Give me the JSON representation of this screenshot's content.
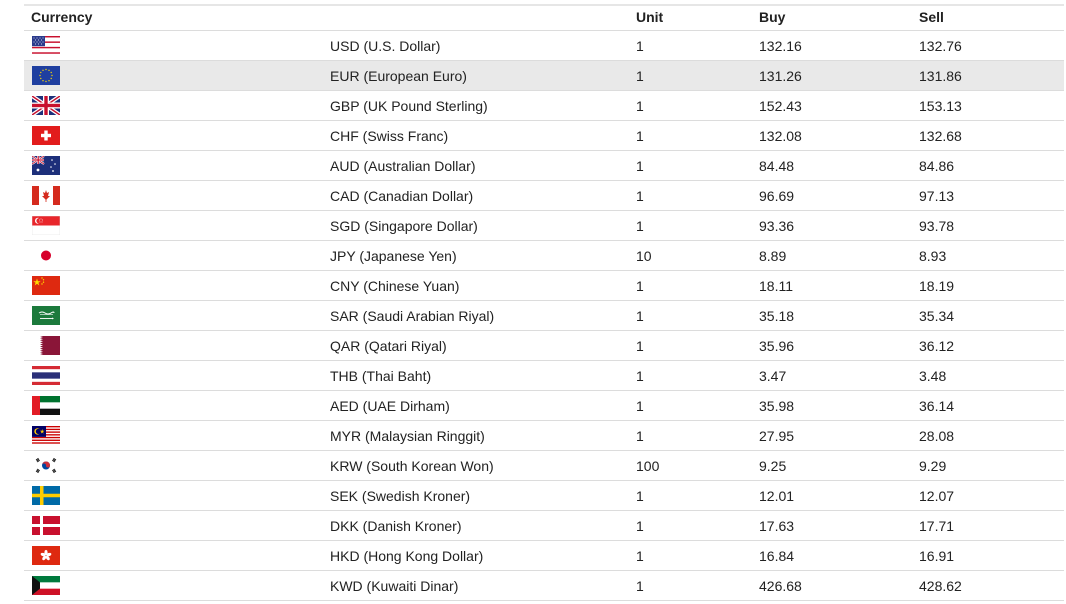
{
  "table": {
    "headers": {
      "currency": "Currency",
      "unit": "Unit",
      "buy": "Buy",
      "sell": "Sell"
    },
    "highlighted_row": 1,
    "rows": [
      {
        "flag": "us-flag-icon",
        "currency": "USD (U.S. Dollar)",
        "unit": "1",
        "buy": "132.16",
        "sell": "132.76"
      },
      {
        "flag": "eu-flag-icon",
        "currency": "EUR (European Euro)",
        "unit": "1",
        "buy": "131.26",
        "sell": "131.86"
      },
      {
        "flag": "uk-flag-icon",
        "currency": "GBP (UK Pound Sterling)",
        "unit": "1",
        "buy": "152.43",
        "sell": "153.13"
      },
      {
        "flag": "switzerland-flag-icon",
        "currency": "CHF (Swiss Franc)",
        "unit": "1",
        "buy": "132.08",
        "sell": "132.68"
      },
      {
        "flag": "australia-flag-icon",
        "currency": "AUD (Australian Dollar)",
        "unit": "1",
        "buy": "84.48",
        "sell": "84.86"
      },
      {
        "flag": "canada-flag-icon",
        "currency": "CAD (Canadian Dollar)",
        "unit": "1",
        "buy": "96.69",
        "sell": "97.13"
      },
      {
        "flag": "singapore-flag-icon",
        "currency": "SGD (Singapore Dollar)",
        "unit": "1",
        "buy": "93.36",
        "sell": "93.78"
      },
      {
        "flag": "japan-flag-icon",
        "currency": "JPY (Japanese Yen)",
        "unit": "10",
        "buy": "8.89",
        "sell": "8.93"
      },
      {
        "flag": "china-flag-icon",
        "currency": "CNY (Chinese Yuan)",
        "unit": "1",
        "buy": "18.11",
        "sell": "18.19"
      },
      {
        "flag": "saudi-arabia-flag-icon",
        "currency": "SAR (Saudi Arabian Riyal)",
        "unit": "1",
        "buy": "35.18",
        "sell": "35.34"
      },
      {
        "flag": "qatar-flag-icon",
        "currency": "QAR (Qatari Riyal)",
        "unit": "1",
        "buy": "35.96",
        "sell": "36.12"
      },
      {
        "flag": "thailand-flag-icon",
        "currency": "THB (Thai Baht)",
        "unit": "1",
        "buy": "3.47",
        "sell": "3.48"
      },
      {
        "flag": "uae-flag-icon",
        "currency": "AED (UAE Dirham)",
        "unit": "1",
        "buy": "35.98",
        "sell": "36.14"
      },
      {
        "flag": "malaysia-flag-icon",
        "currency": "MYR (Malaysian Ringgit)",
        "unit": "1",
        "buy": "27.95",
        "sell": "28.08"
      },
      {
        "flag": "south-korea-flag-icon",
        "currency": "KRW (South Korean Won)",
        "unit": "100",
        "buy": "9.25",
        "sell": "9.29"
      },
      {
        "flag": "sweden-flag-icon",
        "currency": "SEK (Swedish Kroner)",
        "unit": "1",
        "buy": "12.01",
        "sell": "12.07"
      },
      {
        "flag": "denmark-flag-icon",
        "currency": "DKK (Danish Kroner)",
        "unit": "1",
        "buy": "17.63",
        "sell": "17.71"
      },
      {
        "flag": "hong-kong-flag-icon",
        "currency": "HKD (Hong Kong Dollar)",
        "unit": "1",
        "buy": "16.84",
        "sell": "16.91"
      },
      {
        "flag": "kuwait-flag-icon",
        "currency": "KWD (Kuwaiti Dinar)",
        "unit": "1",
        "buy": "426.68",
        "sell": "428.62"
      }
    ]
  },
  "colors": {
    "row_border": "#dcdcdc",
    "highlight_row": "#e9e9e9",
    "text": "#222222"
  }
}
